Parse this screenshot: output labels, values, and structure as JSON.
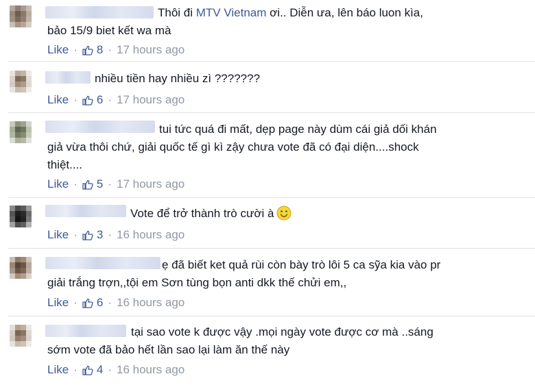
{
  "comments": [
    {
      "text_parts": [
        "Thôi đi ",
        "MTV Vietnam",
        " ơi.. Diễn ưa, lên báo luon kìa,",
        "bảo 15/9 biet kết wa mà"
      ],
      "like_label": "Like",
      "like_count": "8",
      "time": "17 hours ago"
    },
    {
      "text": "nhiều tiền hay nhiều zì ???????",
      "like_label": "Like",
      "like_count": "6",
      "time": "17 hours ago"
    },
    {
      "line1": "tui tức quá đi mất, dẹp page này dùm cái giả dối khán",
      "line2": "giả vừa thôi chứ, giải quốc tế gì kì zậy chưa vote đã có đại diện....shock",
      "line3": "thiệt....",
      "like_label": "Like",
      "like_count": "5",
      "time": "17 hours ago"
    },
    {
      "text": "Vote để trở thành trò cười à",
      "emoji": "smile-emoji",
      "like_label": "Like",
      "like_count": "3",
      "time": "16 hours ago"
    },
    {
      "line1": "ẹ đã biết ket quả rùi còn bày trò lôi 5 ca sỹa kia vào pr",
      "line2": "giải trắng trợn,,tội em Sơn tùng bọn anti dkk thế chửi em,,",
      "like_label": "Like",
      "like_count": "6",
      "time": "16 hours ago"
    },
    {
      "line1": "tại sao vote k được vậy .mọi ngày vote được cơ mà ..sáng",
      "line2": "sớm vote đã bảo hết lần sao lại làm ăn thế này",
      "like_label": "Like",
      "like_count": "4",
      "time": "16 hours ago"
    }
  ],
  "icons": {
    "thumb": "thumbs-up-icon",
    "separator": "·"
  },
  "colors": {
    "link": "#3b5998",
    "meta": "#9197a3",
    "text": "#141823"
  }
}
